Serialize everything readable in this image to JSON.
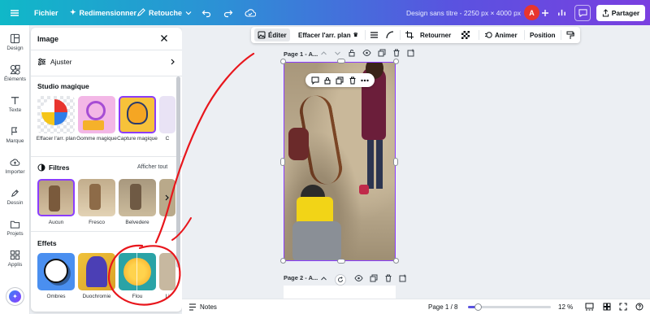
{
  "topbar": {
    "file_label": "Fichier",
    "resize_label": "Redimensionner",
    "retouch_label": "Retouche",
    "design_title": "Design sans titre - 2250 px × 4000 px",
    "avatar_initial": "A",
    "share_label": "Partager"
  },
  "rail": {
    "items": [
      {
        "label": "Design",
        "icon": "layout-icon"
      },
      {
        "label": "Éléments",
        "icon": "shapes-icon"
      },
      {
        "label": "Texte",
        "icon": "text-icon"
      },
      {
        "label": "Marque",
        "icon": "brand-icon"
      },
      {
        "label": "Importer",
        "icon": "upload-icon"
      },
      {
        "label": "Dessin",
        "icon": "pen-icon"
      },
      {
        "label": "Projets",
        "icon": "folder-icon"
      },
      {
        "label": "Applis",
        "icon": "apps-icon"
      }
    ]
  },
  "panel": {
    "title": "Image",
    "adjust_label": "Ajuster",
    "magic_studio": "Studio magique",
    "magic_items": [
      "Effacer l'arr. plan",
      "Gomme magique",
      "Capture magique",
      "C"
    ],
    "filters_title": "Filtres",
    "show_all": "Afficher tout",
    "filters": [
      "Aucun",
      "Fresco",
      "Belvedere"
    ],
    "effects_title": "Effets",
    "effects": [
      "Ombres",
      "Duochromie",
      "Flou",
      "Li"
    ]
  },
  "ctx_toolbar": {
    "edit": "Éditer",
    "remove_bg": "Effacer l'arr. plan",
    "flip": "Retourner",
    "animate": "Animer",
    "position": "Position"
  },
  "canvas": {
    "page1_label": "Page 1 - A...",
    "page2_label": "Page 2 - A..."
  },
  "bottombar": {
    "notes": "Notes",
    "page_indicator": "Page 1 / 8",
    "zoom": "12 %",
    "zoom_value": 12
  },
  "colors": {
    "accent": "#8b3dff",
    "annotation_red": "#e8161c",
    "avatar_bg": "#e8352e"
  }
}
